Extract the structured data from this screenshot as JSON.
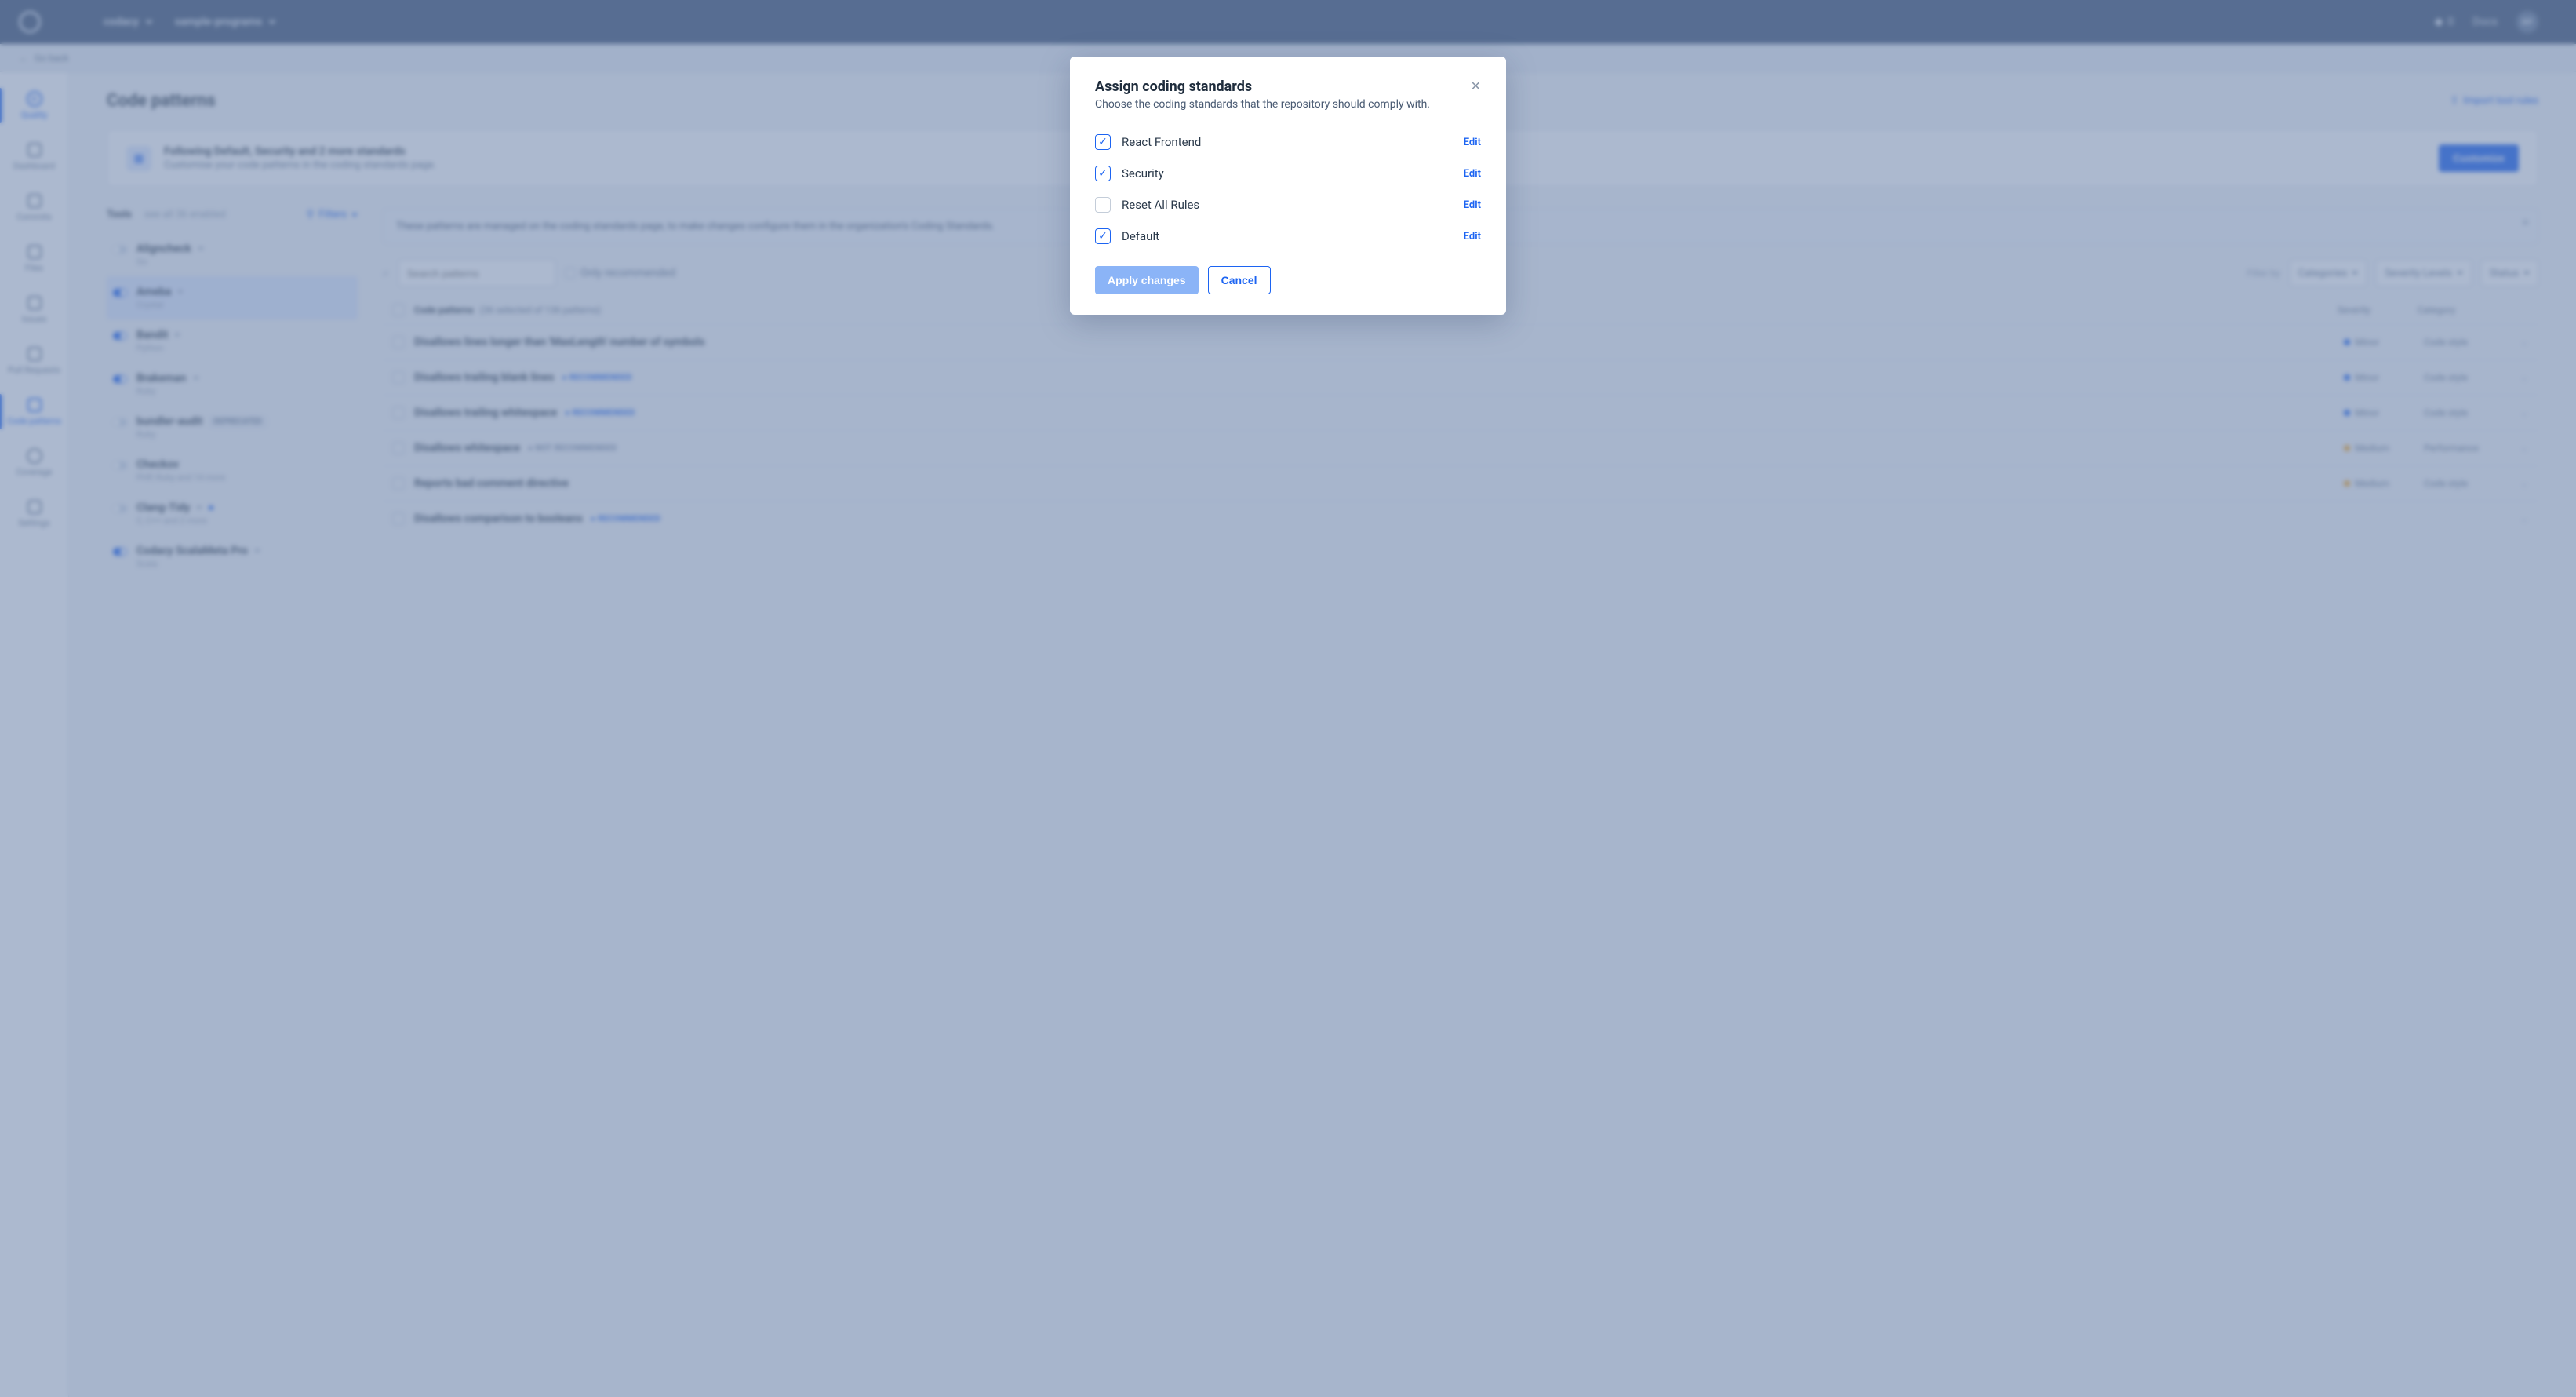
{
  "topbar": {
    "org": "codacy",
    "repo": "sample-programs",
    "credits": "0",
    "docs": "Docs",
    "avatar_initials": "RP"
  },
  "subheader": {
    "back_label": "Go back"
  },
  "sidebar": {
    "items": [
      {
        "label": "Quality"
      },
      {
        "label": "Dashboard"
      },
      {
        "label": "Commits"
      },
      {
        "label": "Files"
      },
      {
        "label": "Issues"
      },
      {
        "label": "Pull Requests"
      },
      {
        "label": "Code patterns"
      },
      {
        "label": "Coverage"
      },
      {
        "label": "Settings"
      }
    ]
  },
  "page": {
    "title": "Code patterns",
    "import_label": "Import tool rules"
  },
  "notice": {
    "title": "Following Default, Security and 2 more standards",
    "subtitle": "Customise your code patterns in the coding standards page.",
    "button": "Customize"
  },
  "tools": {
    "label": "Tools",
    "hint": "see all 36 enabled",
    "filter_label": "Filters",
    "items": [
      {
        "name": "Aligncheck",
        "langs": "Go",
        "on": false,
        "new": true
      },
      {
        "name": "Ameba",
        "langs": "Crystal",
        "on": true,
        "new": true,
        "active": true
      },
      {
        "name": "Bandit",
        "langs": "Python",
        "on": true,
        "new": true
      },
      {
        "name": "Brakeman",
        "langs": "Ruby",
        "on": true,
        "new": true
      },
      {
        "name": "bundler-audit",
        "langs": "Ruby",
        "on": false,
        "deprecated": true
      },
      {
        "name": "Checkov",
        "langs": "PHP, Ruby and 14 more",
        "on": false
      },
      {
        "name": "Clang-Tidy",
        "langs": "C, C++ and 2 more",
        "on": false,
        "new": true,
        "dot": true
      },
      {
        "name": "Codacy ScalaMeta Pro",
        "langs": "Scala",
        "on": true,
        "new": true
      }
    ]
  },
  "info": {
    "text": "These patterns are managed on the coding standards page, to make changes configure them in the organization's Coding Standards.",
    "link": "coding standards"
  },
  "patterns": {
    "search_placeholder": "Search patterns",
    "recommended_label": "Only recommended",
    "filter_hint": "Filter by",
    "filters": [
      {
        "label": "Categories"
      },
      {
        "label": "Severity Levels"
      },
      {
        "label": "Status"
      }
    ],
    "head": {
      "title": "Code patterns",
      "count": "(36 selected of 136 patterns)",
      "sev": "Severity",
      "cat": "Category"
    },
    "rows": [
      {
        "name": "Disallows lines longer than 'MaxLength' number of symbols",
        "sev": "Minor",
        "sev_color": "#1c64f2",
        "cat": "Code style"
      },
      {
        "name": "Disallows trailing blank lines",
        "tag": "RECOMMENDED",
        "sev": "Minor",
        "sev_color": "#1c64f2",
        "cat": "Code style"
      },
      {
        "name": "Disallows trailing whitespace",
        "tag": "RECOMMENDED",
        "sev": "Minor",
        "sev_color": "#1c64f2",
        "cat": "Code style"
      },
      {
        "name": "Disallows whitespace",
        "tag_gray": "NOT RECOMMENDED",
        "sev": "Medium",
        "sev_color": "#f5a623",
        "cat": "Performance"
      },
      {
        "name": "Reports bad comment directive",
        "sev": "Medium",
        "sev_color": "#f5a623",
        "cat": "Code style"
      },
      {
        "name": "Disallows comparison to booleans",
        "tag": "RECOMMENDED",
        "sev": "",
        "cat": ""
      }
    ]
  },
  "modal": {
    "title": "Assign coding standards",
    "subtitle": "Choose the coding standards that the repository should comply with.",
    "edit_label": "Edit",
    "apply_label": "Apply changes",
    "cancel_label": "Cancel",
    "standards": [
      {
        "name": "React Frontend",
        "checked": true
      },
      {
        "name": "Security",
        "checked": true
      },
      {
        "name": "Reset All Rules",
        "checked": false
      },
      {
        "name": "Default",
        "checked": true
      }
    ]
  }
}
